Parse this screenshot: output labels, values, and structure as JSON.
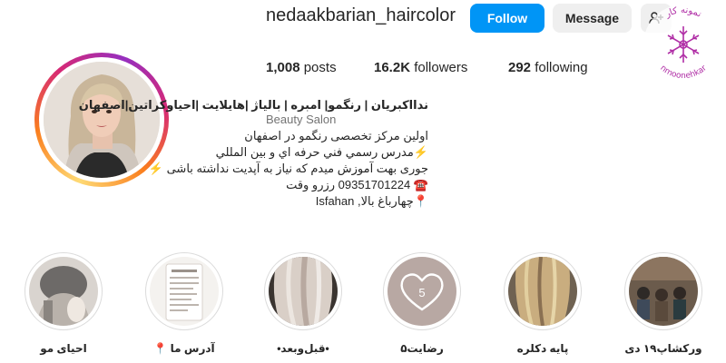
{
  "profile": {
    "username": "nedaakbarian_haircolor",
    "follow_label": "Follow",
    "message_label": "Message",
    "more_icon": "add-person-icon"
  },
  "stats": {
    "posts_count": "1,008",
    "posts_label": "posts",
    "followers_count": "16.2K",
    "followers_label": "followers",
    "following_count": "292",
    "following_label": "following"
  },
  "bio": {
    "name": "ندااکبریان | رنگمو| امبره | بالیاژ |هایلایت |احیاوکراتین|اصفهان",
    "category": "Beauty Salon",
    "line1": "اولین مرکز تخصصی رنگمو در اصفهان",
    "line2": "⚡️مدرس رسمي فني حرفه اي و بين المللي",
    "line3": "جوری بهت آموزش میدم که نیاز به آپدیت نداشته باشی ⚡️",
    "line4": "☎️ 09351701224 رزرو وقت",
    "line5": "📍چهارباغ بالا, Isfahan"
  },
  "stories": [
    {
      "label": "احیای مو",
      "icon": "hair-treatment-thumbnail"
    },
    {
      "label": "آدرس ما 📍",
      "icon": "address-card-thumbnail"
    },
    {
      "label": "•قبل‌وبعد•",
      "icon": "before-after-hair-thumbnail"
    },
    {
      "label": "رضایت۵",
      "icon": "heart-five-icon"
    },
    {
      "label": "پایه دکلره",
      "icon": "blonde-hair-thumbnail"
    },
    {
      "label": "ورکشاپ۱۹ دی",
      "icon": "workshop-thumbnail"
    }
  ],
  "watermark": {
    "text_top": "نمونه کار",
    "text_bottom": "nmoonehkar"
  },
  "colors": {
    "follow_blue": "#0095f6",
    "button_gray": "#efefef",
    "watermark_purple": "#b02fa6"
  }
}
